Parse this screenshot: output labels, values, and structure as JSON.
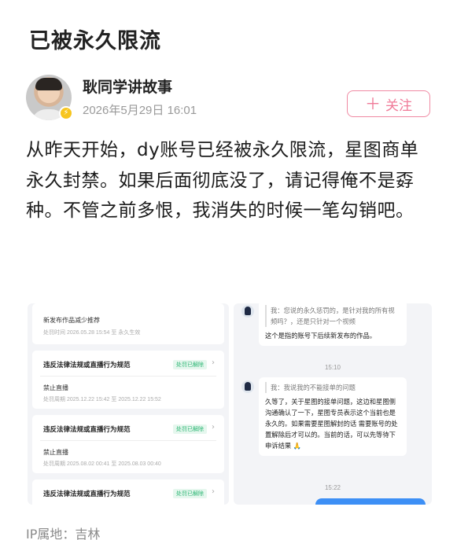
{
  "post": {
    "title": "已被永久限流",
    "author": "耿同学讲故事",
    "time": "2026年5月29日 16:01",
    "follow_label": "关注",
    "body": "从昨天开始，dy账号已经被永久限流，星图商单永久封禁。如果后面彻底没了，请记得俺不是孬种。不管之前多恨，我消失的时候一笔勾销吧。",
    "ip": "IP属地：吉林"
  },
  "screenshot_left": {
    "top_card": {
      "subtitle": "新发布作品减少推荐",
      "meta": "处罚时间 2026.05.28 15:54 至 永久生效"
    },
    "cards": [
      {
        "title": "违反法律法规或直播行为规范",
        "status": "处罚已解除",
        "sub": "禁止直播",
        "meta": "处罚周期 2025.12.22 15:42 至 2025.12.22 15:52"
      },
      {
        "title": "违反法律法规或直播行为规范",
        "status": "处罚已解除",
        "sub": "禁止直播",
        "meta": "处罚周期 2025.08.02 00:41 至 2025.08.03 00:40"
      },
      {
        "title": "违反法律法规或直播行为规范",
        "status": "处罚已解除"
      }
    ]
  },
  "screenshot_right": {
    "msg1_quote": "我：您说的永久惩罚的，是针对我的所有视频吗？，还是只针对一个视频",
    "msg1_reply": "这个是指的账号下后续新发布的作品。",
    "time1": "15:10",
    "msg2_quote": "我：我说我的不能接单的问题",
    "msg2_reply": "久等了，关于星图的接单问题，这边和星图侧沟通确认了一下，星图专员表示这个当前也是永久的。如果需要星图解封的话 需要账号的处置解除后才可以的。当前的话，可以先等待下申诉结果 🙏",
    "time2": "15:22"
  },
  "colors": {
    "follow": "#f07a98",
    "status_green": "#2bb673",
    "sent_blue": "#3d8ff5"
  },
  "icons": {
    "verified": "verified-badge-icon",
    "plus": "plus-icon",
    "chevron": "chevron-right-icon"
  }
}
